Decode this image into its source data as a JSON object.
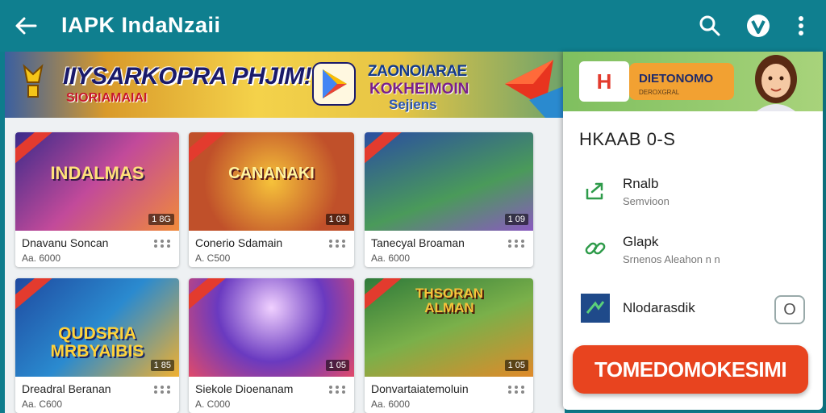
{
  "appbar": {
    "title": "IAPK IndaNzaii",
    "back_icon": "arrow-left-icon",
    "search_icon": "search-icon",
    "account_icon": "account-icon",
    "more_icon": "more-vert-icon"
  },
  "banner": {
    "headline": "IIYSARKOPRA PHJIM!",
    "subline": "SIORIAMAIAI",
    "right_line1": "ZAONOIARAE",
    "right_line2": "KOKHEIMOIN",
    "right_line3": "Sejiens"
  },
  "cards": [
    {
      "art_text": "INDALMAS",
      "badge": "1 8G",
      "name": "Dnavanu Soncan",
      "price": "Aa. 6000",
      "art_colors": [
        "#6b3fa0",
        "#d36a2a"
      ]
    },
    {
      "art_text": "CANANAKI",
      "badge": "1 03",
      "name": "Conerio Sdamain",
      "price": "A. C500",
      "art_colors": [
        "#c0502a",
        "#f2b53a"
      ]
    },
    {
      "art_text": "",
      "badge": "1 09",
      "name": "Tanecyal Broaman",
      "price": "Aa. 6000",
      "art_colors": [
        "#2b5aa8",
        "#5fa04a"
      ]
    },
    {
      "art_text": "QUDSRIA MRBYAIBIS",
      "badge": "1 85",
      "name": "Dreadral Beranan",
      "price": "Aa. C600",
      "art_colors": [
        "#1f4aa0",
        "#f0b030"
      ]
    },
    {
      "art_text": "",
      "badge": "1 05",
      "name": "Siekole Dioenanam",
      "price": "A. C000",
      "art_colors": [
        "#3b2a8a",
        "#e04a6a"
      ]
    },
    {
      "art_text": "THSORAN ALMAN",
      "badge": "1 05",
      "name": "Donvartaiatemoluin",
      "price": "Aa. 6000",
      "art_colors": [
        "#2f7a3a",
        "#e08a2a"
      ]
    }
  ],
  "panel": {
    "logo": "H",
    "pill_title": "DIETONOMO",
    "pill_sub": "DEROXGRAL",
    "title": "HKAAB 0-S",
    "rows": [
      {
        "icon": "share-icon",
        "title": "Rnalb",
        "sub": "Semvioon"
      },
      {
        "icon": "link-icon",
        "title": "Glapk",
        "sub": "Srnenos Aleahon n n"
      },
      {
        "icon": "app-icon",
        "title": "Nlodarasdik",
        "sub": ""
      }
    ],
    "toggle_text": "O",
    "button_label": "TOMEDOMOKESIMI"
  },
  "colors": {
    "appbar": "#0f7f8f",
    "accent": "#e8441f",
    "green": "#2e9b4a"
  }
}
